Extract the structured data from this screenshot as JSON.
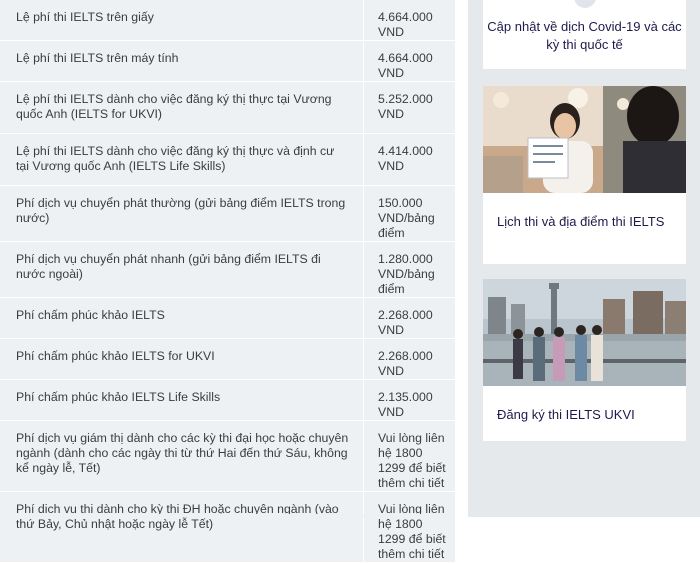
{
  "fees": [
    {
      "name": "Lệ phí thi IELTS trên giấy",
      "price": "4.664.000 VND"
    },
    {
      "name": "Lệ phí thi IELTS trên máy tính",
      "price": "4.664.000 VND"
    },
    {
      "name": "Lệ phí thi IELTS dành cho việc đăng ký thị thực tại Vương quốc Anh (IELTS for UKVI)",
      "price": "5.252.000 VND"
    },
    {
      "name": "Lệ phí thi IELTS dành cho việc đăng ký thị thực và định cư tại Vương quốc Anh (IELTS Life Skills)",
      "price": "4.414.000 VND"
    },
    {
      "name": "Phí dịch vụ chuyển phát thường (gửi bảng điểm IELTS trong nước)",
      "price": "150.000 VND/bảng điểm"
    },
    {
      "name": "Phí dịch vụ chuyển phát nhanh (gửi bảng điểm IELTS đi nước ngoài)",
      "price": "1.280.000 VND/bảng điểm"
    },
    {
      "name": "Phí chấm phúc khảo IELTS",
      "price": "2.268.000 VND"
    },
    {
      "name": "Phí chấm phúc khảo IELTS for UKVI",
      "price": "2.268.000 VND"
    },
    {
      "name": "Phí chấm phúc khảo IELTS Life Skills",
      "price": "2.135.000 VND"
    },
    {
      "name": "Phí dịch vụ giám thị dành cho các kỳ thi đại học hoặc chuyên ngành (dành cho các ngày thi từ thứ Hai đến thứ Sáu, không kể ngày lễ, Tết)",
      "price": "Vui lòng liên hệ 1800 1299 để biết thêm chi tiết"
    },
    {
      "name": "Phí dịch vụ thi dành cho kỳ thi ĐH hoặc chuyên ngành (vào thứ Bảy, Chủ nhật hoặc ngày lễ Tết)",
      "price": "Vui lòng liên hệ 1800 1299 để biết thêm chi tiết"
    }
  ],
  "sidebar": {
    "covid_title": "Cập nhật về dịch Covid-19 và các kỳ thi quốc tế",
    "card1_caption": "Lịch thi và địa điểm thi IELTS",
    "card2_caption": "Đăng ký thi IELTS UKVI"
  },
  "colors": {
    "table_bg": "#eef1f3",
    "sidebar_bg": "#e6e9ec",
    "link_text": "#1d1b4b"
  },
  "icons": {
    "covid_card": "info-icon"
  }
}
